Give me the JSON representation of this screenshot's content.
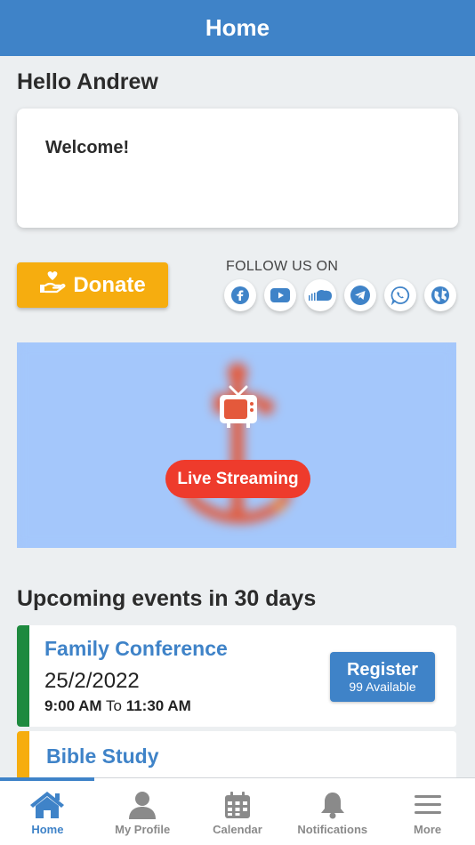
{
  "header": {
    "title": "Home"
  },
  "greeting": "Hello Andrew",
  "welcome_card": {
    "text": "Welcome!"
  },
  "donate": {
    "label": "Donate"
  },
  "follow": {
    "label": "FOLLOW US ON",
    "icons": [
      "facebook-icon",
      "youtube-icon",
      "soundcloud-icon",
      "telegram-icon",
      "whatsapp-icon",
      "website-globe-icon"
    ]
  },
  "stream": {
    "label": "Live Streaming"
  },
  "events": {
    "title": "Upcoming events in 30 days",
    "items": [
      {
        "title": "Family Conference",
        "date": "25/2/2022",
        "start": "9:00 AM",
        "to": "To",
        "end": "11:30 AM",
        "register_label": "Register",
        "available": "99 Available",
        "stripe_color": "#1e8a3f"
      },
      {
        "title": "Bible Study",
        "stripe_color": "#f6ad0f"
      }
    ]
  },
  "tabbar": {
    "items": [
      {
        "label": "Home",
        "icon": "home-icon",
        "active": true
      },
      {
        "label": "My Profile",
        "icon": "person-icon",
        "active": false
      },
      {
        "label": "Calendar",
        "icon": "calendar-icon",
        "active": false
      },
      {
        "label": "Notifications",
        "icon": "bell-icon",
        "active": false
      },
      {
        "label": "More",
        "icon": "menu-icon",
        "active": false
      }
    ]
  },
  "colors": {
    "primary": "#3f83c8",
    "donate": "#f6ad0f",
    "live": "#ee3b2c",
    "stream_bg": "#a4c7fb"
  }
}
